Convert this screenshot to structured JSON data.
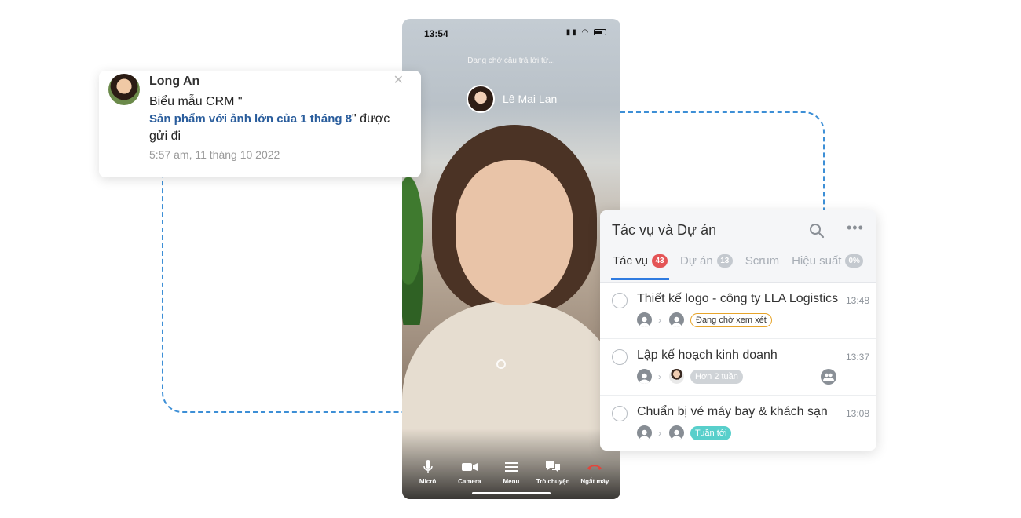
{
  "notification": {
    "sender": "Long An",
    "message_prefix": "Biểu mẫu CRM \"",
    "message_link": "Sản phẩm với ảnh lớn của 1 tháng 8",
    "message_suffix": "\" được gửi đi",
    "timestamp": "5:57 am, 11 tháng 10 2022",
    "close_glyph": "✕"
  },
  "phone": {
    "status_time": "13:54",
    "waiting_text": "Đang chờ câu trả lời từ...",
    "callee_name": "Lê Mai Lan",
    "controls": [
      {
        "label": "Micrô",
        "icon": "microphone-icon"
      },
      {
        "label": "Camera",
        "icon": "camera-icon"
      },
      {
        "label": "Menu",
        "icon": "menu-icon"
      },
      {
        "label": "Trò chuyện",
        "icon": "chat-icon"
      },
      {
        "label": "Ngắt máy",
        "icon": "hang-up-icon"
      }
    ],
    "hangup_color": "#e2453c"
  },
  "tasks": {
    "title": "Tác vụ và Dự án",
    "more_glyph": "•••",
    "tabs": [
      {
        "label": "Tác vụ",
        "count": "43",
        "active": true
      },
      {
        "label": "Dự án",
        "count": "13",
        "active": false
      },
      {
        "label": "Scrum",
        "count": "",
        "active": false
      },
      {
        "label": "Hiệu suất",
        "count": "0%",
        "active": false
      }
    ],
    "items": [
      {
        "title": "Thiết kế logo - công ty LLA Logistics",
        "time": "13:48",
        "tag": "Đang chờ xem xét",
        "tag_style": "pending"
      },
      {
        "title": "Lập kế hoạch kinh doanh",
        "time": "13:37",
        "tag": "Hơn 2 tuần",
        "tag_style": "grey"
      },
      {
        "title": "Chuẩn bị vé máy bay & khách sạn",
        "time": "13:08",
        "tag": "Tuần tới",
        "tag_style": "teal"
      }
    ],
    "accent": "#2f7be0"
  }
}
